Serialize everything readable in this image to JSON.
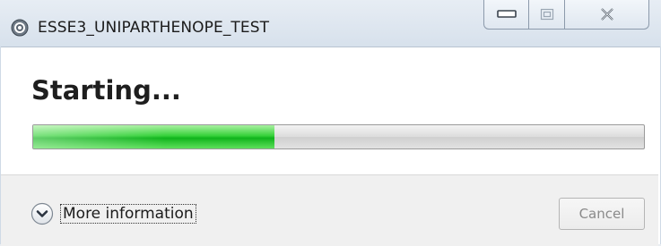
{
  "window": {
    "title": "ESSE3_UNIPARTHENOPE_TEST",
    "app_icon": "java-web-start-icon",
    "controls": {
      "minimize_icon": "minimize-icon",
      "maximize_icon": "maximize-icon",
      "close_icon": "close-icon"
    }
  },
  "status": {
    "heading": "Starting...",
    "progress_percent": 39.5
  },
  "footer": {
    "more_info_label": "More information",
    "more_info_icon": "chevron-down-icon",
    "cancel_label": "Cancel",
    "cancel_enabled": false
  },
  "colors": {
    "progress_green": "#1cbf2a",
    "titlebar": "#dbe4ee",
    "footer": "#f0f0f0"
  }
}
